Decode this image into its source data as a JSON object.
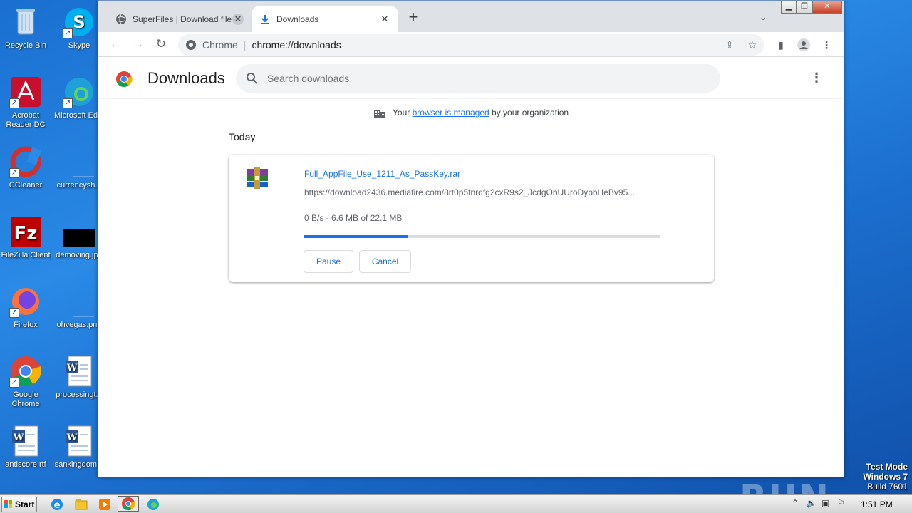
{
  "desktop": {
    "icons": [
      {
        "label": "Recycle Bin"
      },
      {
        "label": "Skype"
      },
      {
        "label": "Acrobat Reader DC"
      },
      {
        "label": "Microsoft Edge"
      },
      {
        "label": "CCleaner"
      },
      {
        "label": "currencysh..."
      },
      {
        "label": "FileZilla Client"
      },
      {
        "label": "demoving.jpg"
      },
      {
        "label": "Firefox"
      },
      {
        "label": "ohvegas.png"
      },
      {
        "label": "Google Chrome"
      },
      {
        "label": "processingt..."
      },
      {
        "label": "antiscore.rtf"
      },
      {
        "label": "sankingdom..."
      }
    ],
    "watermark": "ANY RUN",
    "test_mode": {
      "line1": "Test Mode",
      "line2": "Windows 7",
      "line3": "Build 7601"
    }
  },
  "browser": {
    "tabs": [
      {
        "title": "SuperFiles | Download file ID",
        "active": false
      },
      {
        "title": "Downloads",
        "active": true
      }
    ],
    "new_tab": "+",
    "omnibox": {
      "site": "Chrome",
      "url": "chrome://downloads"
    }
  },
  "downloads": {
    "title": "Downloads",
    "search_placeholder": "Search downloads",
    "managed": {
      "prefix": "Your ",
      "link": "browser is managed",
      "suffix": " by your organization"
    },
    "section": "Today",
    "item": {
      "filename": "Full_AppFile_Use_1211_As_PassKey.rar",
      "url": "https://download2436.mediafire.com/8rt0p5fnrdfg2cxR9s2_JcdgObUUroDybbHeBv95...",
      "status": "0 B/s - 6.6 MB of 22.1 MB",
      "progress_fraction": 0.29,
      "pause_label": "Pause",
      "cancel_label": "Cancel"
    }
  },
  "taskbar": {
    "start_label": "Start",
    "clock": "1:51 PM"
  },
  "colors": {
    "accent": "#1a73e8",
    "desktop": "#1c74d8"
  }
}
